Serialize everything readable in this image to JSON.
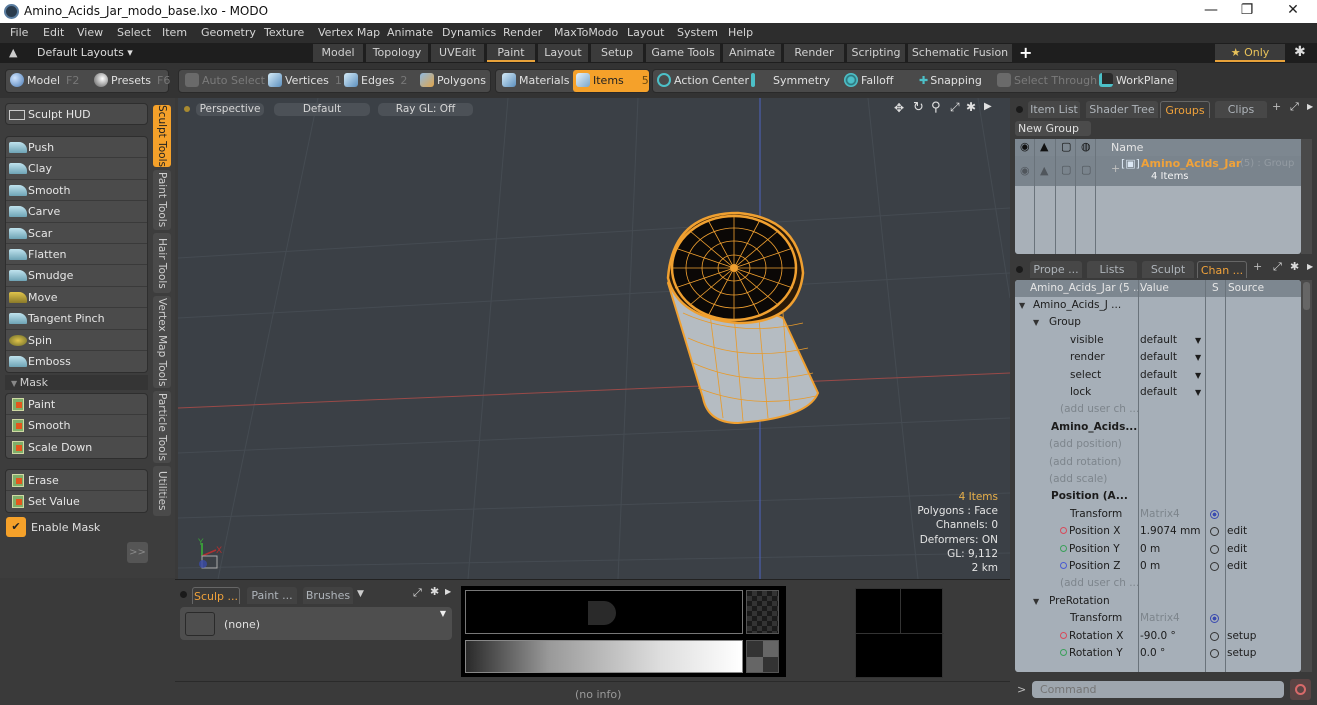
{
  "window": {
    "title": "Amino_Acids_Jar_modo_base.lxo - MODO",
    "controls": {
      "minimize": "—",
      "maximize": "❐",
      "close": "✕"
    }
  },
  "menu": [
    "File",
    "Edit",
    "View",
    "Select",
    "Item",
    "Geometry",
    "Texture",
    "Vertex Map",
    "Animate",
    "Dynamics",
    "Render",
    "MaxToModo",
    "Layout",
    "System",
    "Help"
  ],
  "layout_bar": {
    "layouts_label": "Default Layouts ▾",
    "tabs": [
      "Model",
      "Topology",
      "UVEdit",
      "Paint",
      "Layout",
      "Setup",
      "Game Tools",
      "Animate",
      "Render",
      "Scripting",
      "Schematic Fusion"
    ],
    "active_tab": "Paint",
    "add_label": "+",
    "only_label": "★ Only",
    "accent": "#e8a23a"
  },
  "toolbar": {
    "model": {
      "label": "Model",
      "key": "F2"
    },
    "presets": {
      "label": "Presets",
      "key": "F6"
    },
    "auto_select": "Auto Select",
    "vertices": {
      "label": "Vertices",
      "key": "1"
    },
    "edges": {
      "label": "Edges",
      "key": "2"
    },
    "polygons": {
      "label": "Polygons",
      "key": ""
    },
    "materials": "Materials",
    "items": {
      "label": "Items",
      "key": "5"
    },
    "action_center": "Action Center",
    "symmetry": "Symmetry",
    "falloff": "Falloff",
    "snapping": "Snapping",
    "select_through": "Select Through",
    "workplane": "WorkPlane"
  },
  "left_panel": {
    "sculpt_hud": "Sculpt HUD",
    "sculpt_tools": [
      "Push",
      "Clay",
      "Smooth",
      "Carve",
      "Scar",
      "Flatten",
      "Smudge",
      "Move",
      "Tangent Pinch",
      "Spin",
      "Emboss"
    ],
    "mask_header": "Mask",
    "mask_tools": [
      "Paint",
      "Smooth",
      "Scale Down"
    ],
    "mask_tools2": [
      "Erase",
      "Set Value"
    ],
    "enable_mask": {
      "label": "Enable Mask",
      "checked": true
    },
    "more_button": ">>",
    "vertical_tabs": [
      "Sculpt Tools",
      "Paint Tools",
      "Hair Tools",
      "Vertex Map Tools",
      "Particle Tools",
      "Utilities"
    ],
    "active_vertical_tab": "Sculpt Tools"
  },
  "viewport": {
    "view_type": "Perspective",
    "shading": "Default",
    "raygl": "Ray GL: Off",
    "info": {
      "items": "4 Items",
      "polygons": "Polygons : Face",
      "channels": "Channels: 0",
      "deformers": "Deformers: ON",
      "gl": "GL: 9,112",
      "scale": "2 km"
    },
    "axis_labels": {
      "y": "Y",
      "x": "X"
    }
  },
  "bottom_panel": {
    "tabs": [
      "Sculp ...",
      "Paint ...",
      "Brushes"
    ],
    "active_tab": "Sculp ...",
    "preset_value": "(none)"
  },
  "status_bar": {
    "info": "(no info)"
  },
  "right_panel": {
    "top_tabs": [
      "Item List",
      "Shader Tree",
      "Groups",
      "Clips"
    ],
    "top_active": "Groups",
    "new_group": "New Group",
    "groups_header": "Name",
    "group": {
      "name": "Amino_Acids_Jar",
      "suffix": "(5) : Group",
      "count": "4 Items"
    },
    "bottom_tabs": [
      "Prope ...",
      "Lists",
      "Sculpt",
      "Chan ..."
    ],
    "bottom_active": "Chan ...",
    "channels_columns": [
      "Amino_Acids_Jar (5 ...",
      "Value",
      "S",
      "Source"
    ],
    "channels": [
      {
        "name": "Amino_Acids_J ...",
        "value": "",
        "source": "",
        "style": "item"
      },
      {
        "name": "Group",
        "value": "",
        "source": "",
        "style": "sub"
      },
      {
        "name": "visible",
        "value": "default",
        "source": "",
        "style": "dropdown"
      },
      {
        "name": "render",
        "value": "default",
        "source": "",
        "style": "dropdown"
      },
      {
        "name": "select",
        "value": "default",
        "source": "",
        "style": "dropdown"
      },
      {
        "name": "lock",
        "value": "default",
        "source": "",
        "style": "dropdown"
      },
      {
        "name": "(add user ch ...",
        "value": "",
        "source": "",
        "style": "dim"
      },
      {
        "name": "Amino_Acids...",
        "value": "",
        "source": "",
        "style": "bold"
      },
      {
        "name": "(add position)",
        "value": "",
        "source": "",
        "style": "dim"
      },
      {
        "name": "(add rotation)",
        "value": "",
        "source": "",
        "style": "dim"
      },
      {
        "name": "(add scale)",
        "value": "",
        "source": "",
        "style": "dim"
      },
      {
        "name": "Position (A...",
        "value": "",
        "source": "",
        "style": "bold"
      },
      {
        "name": "Transform",
        "value": "Matrix4",
        "source": "",
        "style": "matrix"
      },
      {
        "name": "Position X",
        "value": "1.9074 mm",
        "source": "edit",
        "style": "x"
      },
      {
        "name": "Position Y",
        "value": "0 m",
        "source": "edit",
        "style": "y"
      },
      {
        "name": "Position Z",
        "value": "0 m",
        "source": "edit",
        "style": "z"
      },
      {
        "name": "(add user ch ...",
        "value": "",
        "source": "",
        "style": "dim"
      },
      {
        "name": "PreRotation",
        "value": "",
        "source": "",
        "style": "sub"
      },
      {
        "name": "Transform",
        "value": "Matrix4",
        "source": "",
        "style": "matrix"
      },
      {
        "name": "Rotation X",
        "value": "-90.0 °",
        "source": "setup",
        "style": "x"
      },
      {
        "name": "Rotation Y",
        "value": "0.0 °",
        "source": "setup",
        "style": "y"
      }
    ],
    "command_placeholder": "Command"
  }
}
